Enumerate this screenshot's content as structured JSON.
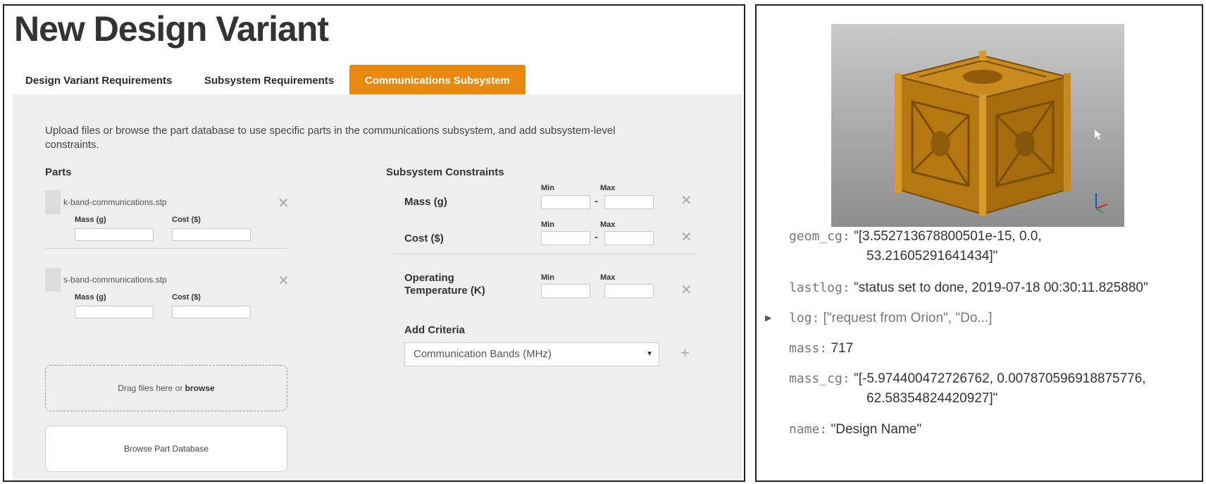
{
  "form": {
    "title": "New Design Variant",
    "tabs": [
      {
        "label": "Design Variant Requirements"
      },
      {
        "label": "Subsystem Requirements"
      },
      {
        "label": "Communications Subsystem"
      }
    ],
    "intro": "Upload files or browse the part database to use specific parts in the communications subsystem, and add subsystem-level constraints.",
    "parts_title": "Parts",
    "parts": [
      {
        "name": "k-band-communications.stp",
        "mass_label": "Mass (g)",
        "cost_label": "Cost ($)"
      },
      {
        "name": "s-band-communications.stp",
        "mass_label": "Mass (g)",
        "cost_label": "Cost ($)"
      }
    ],
    "dropzone_text": "Drag files here or ",
    "dropzone_link": "browse",
    "browse_button": "Browse Part Database",
    "constraints_title": "Subsystem Constraints",
    "constraints": [
      {
        "label": "Mass (g)",
        "min_label": "Min",
        "max_label": "Max"
      },
      {
        "label": "Cost ($)",
        "min_label": "Min",
        "max_label": "Max"
      },
      {
        "label_line1": "Operating",
        "label_line2": "Temperature (K)",
        "min_label": "Min",
        "max_label": "Max"
      }
    ],
    "dash": "-",
    "add_criteria_title": "Add Criteria",
    "criteria_select": "Communication Bands (MHz)",
    "colors": {
      "accent": "#e88a12",
      "panel_bg": "#efefef"
    }
  },
  "inspector": {
    "image_alt": "cubesat-model",
    "fields": [
      {
        "key": "geom_cg",
        "value_line1": "\"[3.552713678800501e-15, 0.0,",
        "value_line2": "53.21605291641434]\""
      },
      {
        "key": "lastlog",
        "value_line1": "\"status set to done, 2019-07-18 00:30:11.825880\""
      },
      {
        "key": "log",
        "value_line1": "[\"request from Orion\", \"Do...]"
      },
      {
        "key": "mass",
        "value_line1": "717"
      },
      {
        "key": "mass_cg",
        "value_line1": "\"[-5.974400472726762, 0.007870596918875776,",
        "value_line2": "62.58354824420927]\""
      },
      {
        "key": "name",
        "value_line1": "\"Design Name\""
      }
    ],
    "colon": ":"
  }
}
